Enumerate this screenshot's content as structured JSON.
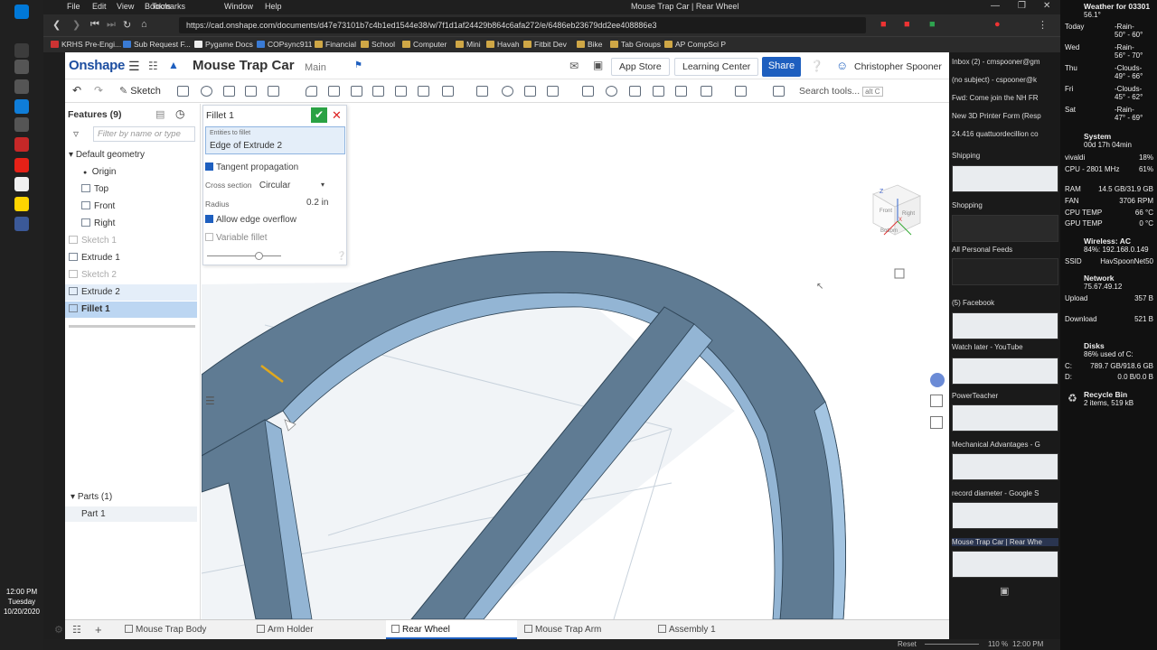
{
  "browser": {
    "menu": [
      "File",
      "Edit",
      "View",
      "Tools",
      "Bookmarks",
      "Window",
      "Help"
    ],
    "window_title": "Mouse Trap Car | Rear Wheel",
    "url": "https://cad.onshape.com/documents/d47e73101b7c4b1ed1544e38/w/7f1d1af24429b864c6afa272/e/6486eb23679dd2ee408886e3",
    "bookmarks": [
      "KRHS Pre-Engi...",
      "Sub Request F...",
      "Pygame Docs",
      "COPsync911",
      "Financial",
      "School",
      "Computer",
      "Mini",
      "Havah",
      "Fitbit Dev",
      "Bike",
      "Tab Groups",
      "AP CompSci P"
    ]
  },
  "app": {
    "logo": "Onshape",
    "doc_title": "Mouse Trap Car",
    "branch": "Main",
    "app_store": "App Store",
    "learning_center": "Learning Center",
    "share": "Share",
    "user": "Christopher Spooner",
    "sketch_label": "Sketch",
    "search_tools": "Search tools...",
    "search_kbd": "alt C"
  },
  "features": {
    "title": "Features (9)",
    "filter_placeholder": "Filter by name or type",
    "items": [
      {
        "label": "Default geometry"
      },
      {
        "label": "Origin"
      },
      {
        "label": "Top"
      },
      {
        "label": "Front"
      },
      {
        "label": "Right"
      },
      {
        "label": "Sketch 1"
      },
      {
        "label": "Extrude 1"
      },
      {
        "label": "Sketch 2"
      },
      {
        "label": "Extrude 2"
      },
      {
        "label": "Fillet 1"
      }
    ],
    "parts_title": "Parts (1)",
    "part": "Part 1"
  },
  "fillet": {
    "title": "Fillet 1",
    "entities_label": "Entities to fillet",
    "entities_value": "Edge of Extrude 2",
    "tangent": "Tangent propagation",
    "cross_section_label": "Cross section",
    "cross_section_value": "Circular",
    "radius_label": "Radius",
    "radius_value": "0.2 in",
    "overflow": "Allow edge overflow",
    "variable": "Variable fillet",
    "slider_position": 0.7
  },
  "tabs": [
    {
      "label": "Mouse Trap Body"
    },
    {
      "label": "Arm Holder"
    },
    {
      "label": "Rear Wheel"
    },
    {
      "label": "Mouse Trap Arm"
    },
    {
      "label": "Assembly 1"
    }
  ],
  "viewcube": {
    "top": "Z",
    "front": "Front",
    "right": "Right",
    "bottom": "Bottom",
    "x": "X"
  },
  "right_feed": [
    "Inbox (2) - cmspooner@gm",
    "(no subject) - cspooner@k",
    "Fwd: Come join the NH FR",
    "New 3D Printer Form (Resp",
    "24.416 quattuordecillion co",
    "Shipping",
    "Shopping",
    "All Personal Feeds",
    "(5) Facebook",
    "Watch later - YouTube",
    "PowerTeacher",
    "Mechanical Advantages - G",
    "record diameter - Google S",
    "Mouse Trap Car | Rear Whe"
  ],
  "system": {
    "weather_title": "Weather for 03301",
    "temp": "56.1°",
    "forecast": [
      {
        "day": "Today",
        "desc": "-Rain-",
        "range": "50° - 60°"
      },
      {
        "day": "Wed",
        "desc": "-Rain-",
        "range": "56° - 70°"
      },
      {
        "day": "Thu",
        "desc": "-Clouds-",
        "range": "49° - 66°"
      },
      {
        "day": "Fri",
        "desc": "-Clouds-",
        "range": "45° - 62°"
      },
      {
        "day": "Sat",
        "desc": "-Rain-",
        "range": "47° - 69°"
      }
    ],
    "system_title": "System",
    "uptime": "00d 17h 04min",
    "host": "vivaldi",
    "host_pct": "18%",
    "cpu": "CPU - 2801 MHz",
    "cpu_pct": "61%",
    "ram": "RAM",
    "ram_v": "14.5 GB/31.9 GB",
    "fan": "FAN",
    "fan_v": "3706 RPM",
    "cpu_temp": "CPU TEMP",
    "cpu_temp_v": "66 °C",
    "gpu_temp": "GPU TEMP",
    "gpu_temp_v": "0 °C",
    "wireless": "Wireless: AC",
    "wireless_info": "84%: 192.168.0.149",
    "ssid": "SSID",
    "ssid_v": "HavSpoonNet50",
    "network": "Network",
    "network_ip": "75.67.49.12",
    "upload": "Upload",
    "upload_v": "357 B",
    "download": "Download",
    "download_v": "521 B",
    "disks": "Disks",
    "disks_info": "86% used of C:",
    "c_drive": "C:",
    "c_v": "789.7 GB/918.6 GB",
    "d_drive": "D:",
    "d_v": "0.0 B/0.0 B",
    "recycle": "Recycle Bin",
    "recycle_info": "2 items, 519 kB"
  },
  "clock": {
    "time": "12:00 PM",
    "day": "Tuesday",
    "date": "10/20/2020"
  },
  "status": {
    "zoom": "110 %",
    "time": "12:00 PM",
    "reset": "Reset"
  }
}
